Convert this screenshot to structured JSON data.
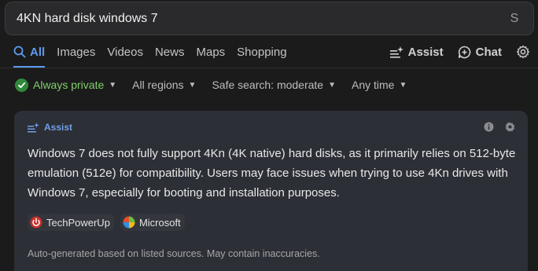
{
  "search": {
    "query": "4KN hard disk windows 7",
    "clear_glyph": "S"
  },
  "tabs": [
    {
      "label": "All",
      "icon": "search-icon",
      "active": true
    },
    {
      "label": "Images"
    },
    {
      "label": "Videos"
    },
    {
      "label": "News"
    },
    {
      "label": "Maps"
    },
    {
      "label": "Shopping"
    }
  ],
  "tab_right": {
    "assist_label": "Assist",
    "chat_label": "Chat",
    "settings_icon": "gear-icon"
  },
  "filters": {
    "private": "Always private",
    "region": "All regions",
    "safe_search": "Safe search: moderate",
    "time": "Any time"
  },
  "assist_card": {
    "label": "Assist",
    "answer": "Windows 7 does not fully support 4Kn (4K native) hard disks, as it primarily relies on 512-byte emulation (512e) for compatibility. Users may face issues when trying to use 4Kn drives with Windows 7, especially for booting and installation purposes.",
    "sources": [
      {
        "name": "TechPowerUp",
        "icon": "techpowerup-icon"
      },
      {
        "name": "Microsoft",
        "icon": "microsoft-icon"
      }
    ],
    "footnote": "Auto-generated based on listed sources. May contain inaccuracies."
  },
  "colors": {
    "accent": "#5d9bf0",
    "private_green": "#7fcf6a",
    "card_bg": "#2d2f36"
  }
}
